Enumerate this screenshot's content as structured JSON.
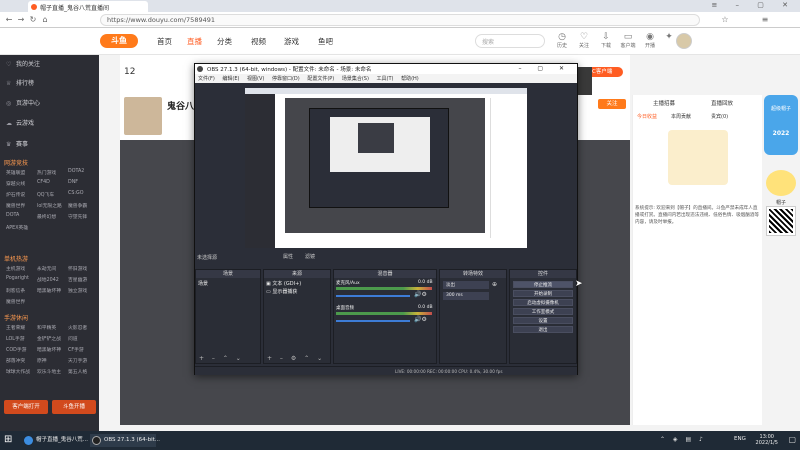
{
  "browser": {
    "tab_title": "帽子直播_鬼谷八荒直播间",
    "url": "https://www.douyu.com/7589491"
  },
  "header": {
    "logo": "斗鱼",
    "nav": [
      "首页",
      "直播",
      "分类",
      "视频",
      "游戏",
      "鱼吧"
    ],
    "search_placeholder": "搜索",
    "icons": [
      {
        "label": "历史",
        "icon": "clock-icon"
      },
      {
        "label": "关注",
        "icon": "heart-icon"
      },
      {
        "label": "下载",
        "icon": "download-icon"
      },
      {
        "label": "客户端",
        "icon": "monitor-icon"
      },
      {
        "label": "开播",
        "icon": "camera-icon"
      },
      {
        "label": "合作中心",
        "icon": "handshake-icon"
      }
    ],
    "badge": "4"
  },
  "sidebar": {
    "items": [
      "我的关注",
      "排行榜",
      "页游中心",
      "云游戏",
      "赛事"
    ],
    "groups": [
      {
        "title": "网游竞技",
        "cells": [
          "英雄联盟",
          "热门游戏",
          "DOTA2",
          "穿越火线",
          "CF4D",
          "DNF",
          "炉石传说",
          "QQ飞车",
          "CS:GO",
          "魔兽世界",
          "lol无限之路",
          "魔兽争霸",
          "DOTA",
          "最终幻想",
          "守望先锋",
          "APEX英雄"
        ]
      },
      {
        "title": "单机热游",
        "cells": [
          "主机游戏",
          "永劫无间",
          "怀旧游戏",
          "Pogaright",
          "战地2042",
          "吉星幽游",
          "刺客信条",
          "暗黑破坏神",
          "独立游戏",
          "魔兽世界"
        ]
      },
      {
        "title": "手游休闲",
        "cells": [
          "王者荣耀",
          "和平精英",
          "火影忍者",
          "LOL手游",
          "金铲铲之战",
          "问道",
          "COD手游",
          "暗黑破坏神",
          "CF手游",
          "部落冲突",
          "原神",
          "天刀手游",
          "球球大作战",
          "欢乐斗地主",
          "第五人格"
        ]
      }
    ],
    "buttons": [
      "客户端打开",
      "斗鱼开播"
    ]
  },
  "room": {
    "title": "鬼谷八荒",
    "tabs": [
      "主播招募",
      "直播回放",
      "粉丝榜",
      "贵宾"
    ],
    "subscribe": "关注",
    "pc_badge": "PC客户端"
  },
  "chat": {
    "tabs": [
      "今日收益",
      "本周贡献",
      "贵宾(0)",
      "粉丝团"
    ],
    "system_msg": "系统提示: 欢迎来到【帽子】的直播间。斗鱼严禁未成年人直播或打赏。直播间内若出现违法违规、低俗色情、吸烟酗酒等内容，请及时举报。"
  },
  "obs": {
    "title": "OBS 27.1.3 (64-bit, windows) - 配置文件: 未命名 - 场景: 未命名",
    "menu": [
      "文件(F)",
      "编辑(E)",
      "视图(V)",
      "停靠窗口(D)",
      "配置文件(P)",
      "场景集合(S)",
      "工具(T)",
      "帮助(H)"
    ],
    "docks": [
      "场景",
      "来源",
      "混音器",
      "转场特效",
      "控件"
    ],
    "scene": "场景",
    "sources": [
      "文本 (GDI+)",
      "显示器捕获"
    ],
    "mixer": [
      {
        "name": "麦克风/Aux",
        "db": "0.0 dB"
      },
      {
        "name": "桌面音频",
        "db": "0.0 dB"
      }
    ],
    "transition": "淡出",
    "duration": "300 ms",
    "controls": [
      "停止推流",
      "开始录制",
      "启动虚拟摄像机",
      "工作室模式",
      "设置",
      "退出"
    ],
    "status": "LIVE: 00:00:00   REC: 00:00:00   CPU: 0.4%, 30.00 fps",
    "no_source": "未选择源",
    "props": [
      "属性",
      "滤镜"
    ]
  },
  "widget": {
    "title": "超级帽子",
    "event": "2022",
    "name": "帽子"
  },
  "taskbar": {
    "apps": [
      "帽子直播_鬼谷八荒...",
      "OBS 27.1.3 (64-bit..."
    ],
    "lang": "ENG",
    "time": "13:00",
    "date": "2022/1/5"
  },
  "colors": {
    "accent": "#ff7a1a",
    "sidebar_bg": "#2c2d34",
    "obs_bg": "#2b2e38",
    "taskbar": "#1f2a36"
  }
}
